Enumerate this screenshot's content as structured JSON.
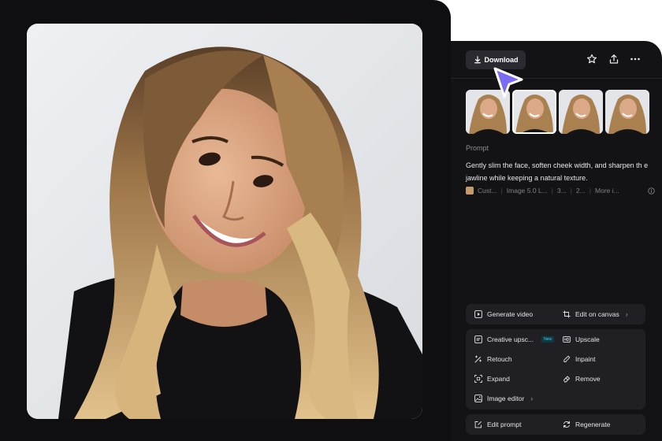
{
  "toolbar": {
    "download_label": "Download"
  },
  "prompt": {
    "label": "Prompt",
    "text": "Gently slim the face, soften cheek width, and sharpen th e jawline while keeping a natural texture."
  },
  "meta": {
    "items": [
      "Cust...",
      "Image 5.0 L...",
      "3...",
      "2...",
      "More i..."
    ]
  },
  "actions": {
    "generate_video": "Generate video",
    "edit_on_canvas": "Edit on canvas",
    "creative_upscale": "Creative upsc...",
    "creative_badge": "New",
    "upscale": "Upscale",
    "retouch": "Retouch",
    "inpaint": "Inpaint",
    "expand": "Expand",
    "remove": "Remove",
    "image_editor": "Image editor",
    "edit_prompt": "Edit prompt",
    "regenerate": "Regenerate"
  },
  "icons": [
    "download-icon",
    "star-icon",
    "share-icon",
    "more-icon",
    "play-icon",
    "crop-icon",
    "upscale-icon",
    "hd-icon",
    "retouch-icon",
    "inpaint-icon",
    "expand-icon",
    "eraser-icon",
    "image-editor-icon",
    "edit-icon",
    "regenerate-icon",
    "info-icon",
    "cursor-icon"
  ],
  "colors": {
    "background": "#0f0f11",
    "panel": "#131316",
    "button": "#2a2a30",
    "action_group": "#1f1f24",
    "cursor_accent": "#7b6cf6",
    "badge": "#38d0e6"
  }
}
